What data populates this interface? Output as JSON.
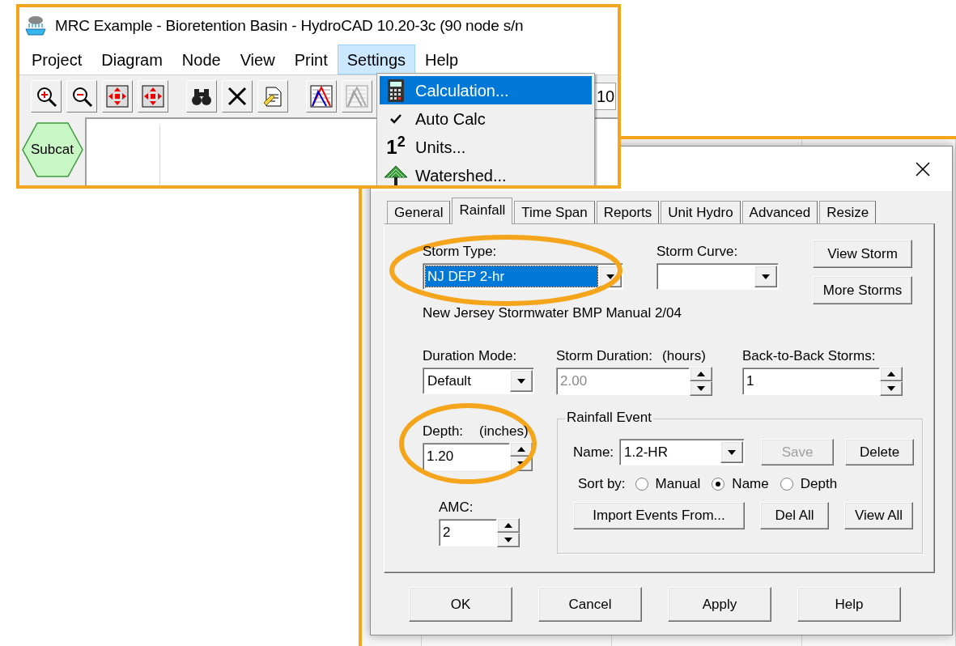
{
  "main_window": {
    "title": "MRC Example - Bioretention Basin - HydroCAD 10.20-3c (90 node s/n",
    "menu": [
      {
        "label": "Project",
        "selected": false
      },
      {
        "label": "Diagram",
        "selected": false
      },
      {
        "label": "Node",
        "selected": false
      },
      {
        "label": "View",
        "selected": false
      },
      {
        "label": "Print",
        "selected": false
      },
      {
        "label": "Settings",
        "selected": true
      },
      {
        "label": "Help",
        "selected": false
      }
    ],
    "toolbar": [
      {
        "kind": "zoom-in",
        "disabled": false
      },
      {
        "kind": "zoom-out",
        "disabled": false
      },
      {
        "kind": "fit",
        "disabled": false
      },
      {
        "kind": "fit",
        "disabled": false
      },
      {
        "kind": "find",
        "disabled": false
      },
      {
        "kind": "delete",
        "disabled": false
      },
      {
        "kind": "edit",
        "disabled": false
      },
      {
        "kind": "chart",
        "disabled": false
      },
      {
        "kind": "chart",
        "disabled": true
      }
    ],
    "toolbar_field": "10",
    "nodes": [
      {
        "label": "Subcat"
      }
    ]
  },
  "settings_menu": [
    {
      "kind": "calculator",
      "label": "Calculation...",
      "selected": true
    },
    {
      "kind": "toggle",
      "label": "Auto Calc",
      "selected": false,
      "checked": true
    },
    {
      "kind": "units",
      "icon_text": "1$^{2}$",
      "label": "Units...",
      "selected": false
    },
    {
      "kind": "watershed",
      "label": "Watershed...",
      "selected": false
    }
  ],
  "dialog": {
    "tabs": [
      {
        "label": "General",
        "selected": false
      },
      {
        "label": "Rainfall",
        "selected": true
      },
      {
        "label": "Time Span",
        "selected": false
      },
      {
        "label": "Reports",
        "selected": false
      },
      {
        "label": "Unit Hydro",
        "selected": false
      },
      {
        "label": "Advanced",
        "selected": false
      },
      {
        "label": "Resize",
        "selected": false
      }
    ],
    "storm_type": {
      "label": "Storm Type:",
      "value": "NJ DEP 2-hr",
      "selected": true
    },
    "storm_curve": {
      "label": "Storm Curve:"
    },
    "side_buttons": [
      "View Storm",
      "More Storms"
    ],
    "storm_description": "New Jersey Stormwater BMP Manual 2/04",
    "duration_mode": {
      "label": "Duration Mode:",
      "value": "Default"
    },
    "storm_duration": {
      "label": "Storm Duration:",
      "unit": "(hours)",
      "value": "2.00",
      "disabled": true
    },
    "back_to_back_storms": {
      "label": "Back-to-Back Storms:",
      "value": "1",
      "disabled": false
    },
    "depth": {
      "label": "Depth:",
      "unit": "(inches)",
      "value": "1.20"
    },
    "amc": {
      "label": "AMC:",
      "value": "2"
    },
    "rainfall_event": {
      "title": "Rainfall Event",
      "name_label": "Name:",
      "name_value": "1.2-HR",
      "buttons": [
        {
          "label": "Save",
          "disabled": true
        },
        {
          "label": "Delete",
          "disabled": false
        }
      ],
      "sort_label": "Sort by:",
      "sort_options": [
        {
          "label": "Manual",
          "selected": false
        },
        {
          "label": "Name",
          "selected": true
        },
        {
          "label": "Depth",
          "selected": false
        }
      ],
      "actions": [
        "Import Events From...",
        "Del All",
        "View All"
      ]
    },
    "buttons": [
      "OK",
      "Cancel",
      "Apply",
      "Help"
    ]
  }
}
